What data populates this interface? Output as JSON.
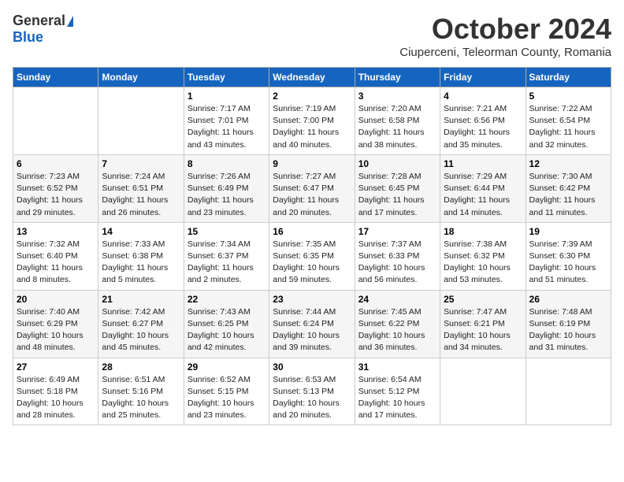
{
  "logo": {
    "general": "General",
    "blue": "Blue"
  },
  "title": "October 2024",
  "location": "Ciuperceni, Teleorman County, Romania",
  "days_of_week": [
    "Sunday",
    "Monday",
    "Tuesday",
    "Wednesday",
    "Thursday",
    "Friday",
    "Saturday"
  ],
  "weeks": [
    [
      {
        "day": "",
        "info": ""
      },
      {
        "day": "",
        "info": ""
      },
      {
        "day": "1",
        "info": "Sunrise: 7:17 AM\nSunset: 7:01 PM\nDaylight: 11 hours and 43 minutes."
      },
      {
        "day": "2",
        "info": "Sunrise: 7:19 AM\nSunset: 7:00 PM\nDaylight: 11 hours and 40 minutes."
      },
      {
        "day": "3",
        "info": "Sunrise: 7:20 AM\nSunset: 6:58 PM\nDaylight: 11 hours and 38 minutes."
      },
      {
        "day": "4",
        "info": "Sunrise: 7:21 AM\nSunset: 6:56 PM\nDaylight: 11 hours and 35 minutes."
      },
      {
        "day": "5",
        "info": "Sunrise: 7:22 AM\nSunset: 6:54 PM\nDaylight: 11 hours and 32 minutes."
      }
    ],
    [
      {
        "day": "6",
        "info": "Sunrise: 7:23 AM\nSunset: 6:52 PM\nDaylight: 11 hours and 29 minutes."
      },
      {
        "day": "7",
        "info": "Sunrise: 7:24 AM\nSunset: 6:51 PM\nDaylight: 11 hours and 26 minutes."
      },
      {
        "day": "8",
        "info": "Sunrise: 7:26 AM\nSunset: 6:49 PM\nDaylight: 11 hours and 23 minutes."
      },
      {
        "day": "9",
        "info": "Sunrise: 7:27 AM\nSunset: 6:47 PM\nDaylight: 11 hours and 20 minutes."
      },
      {
        "day": "10",
        "info": "Sunrise: 7:28 AM\nSunset: 6:45 PM\nDaylight: 11 hours and 17 minutes."
      },
      {
        "day": "11",
        "info": "Sunrise: 7:29 AM\nSunset: 6:44 PM\nDaylight: 11 hours and 14 minutes."
      },
      {
        "day": "12",
        "info": "Sunrise: 7:30 AM\nSunset: 6:42 PM\nDaylight: 11 hours and 11 minutes."
      }
    ],
    [
      {
        "day": "13",
        "info": "Sunrise: 7:32 AM\nSunset: 6:40 PM\nDaylight: 11 hours and 8 minutes."
      },
      {
        "day": "14",
        "info": "Sunrise: 7:33 AM\nSunset: 6:38 PM\nDaylight: 11 hours and 5 minutes."
      },
      {
        "day": "15",
        "info": "Sunrise: 7:34 AM\nSunset: 6:37 PM\nDaylight: 11 hours and 2 minutes."
      },
      {
        "day": "16",
        "info": "Sunrise: 7:35 AM\nSunset: 6:35 PM\nDaylight: 10 hours and 59 minutes."
      },
      {
        "day": "17",
        "info": "Sunrise: 7:37 AM\nSunset: 6:33 PM\nDaylight: 10 hours and 56 minutes."
      },
      {
        "day": "18",
        "info": "Sunrise: 7:38 AM\nSunset: 6:32 PM\nDaylight: 10 hours and 53 minutes."
      },
      {
        "day": "19",
        "info": "Sunrise: 7:39 AM\nSunset: 6:30 PM\nDaylight: 10 hours and 51 minutes."
      }
    ],
    [
      {
        "day": "20",
        "info": "Sunrise: 7:40 AM\nSunset: 6:29 PM\nDaylight: 10 hours and 48 minutes."
      },
      {
        "day": "21",
        "info": "Sunrise: 7:42 AM\nSunset: 6:27 PM\nDaylight: 10 hours and 45 minutes."
      },
      {
        "day": "22",
        "info": "Sunrise: 7:43 AM\nSunset: 6:25 PM\nDaylight: 10 hours and 42 minutes."
      },
      {
        "day": "23",
        "info": "Sunrise: 7:44 AM\nSunset: 6:24 PM\nDaylight: 10 hours and 39 minutes."
      },
      {
        "day": "24",
        "info": "Sunrise: 7:45 AM\nSunset: 6:22 PM\nDaylight: 10 hours and 36 minutes."
      },
      {
        "day": "25",
        "info": "Sunrise: 7:47 AM\nSunset: 6:21 PM\nDaylight: 10 hours and 34 minutes."
      },
      {
        "day": "26",
        "info": "Sunrise: 7:48 AM\nSunset: 6:19 PM\nDaylight: 10 hours and 31 minutes."
      }
    ],
    [
      {
        "day": "27",
        "info": "Sunrise: 6:49 AM\nSunset: 5:18 PM\nDaylight: 10 hours and 28 minutes."
      },
      {
        "day": "28",
        "info": "Sunrise: 6:51 AM\nSunset: 5:16 PM\nDaylight: 10 hours and 25 minutes."
      },
      {
        "day": "29",
        "info": "Sunrise: 6:52 AM\nSunset: 5:15 PM\nDaylight: 10 hours and 23 minutes."
      },
      {
        "day": "30",
        "info": "Sunrise: 6:53 AM\nSunset: 5:13 PM\nDaylight: 10 hours and 20 minutes."
      },
      {
        "day": "31",
        "info": "Sunrise: 6:54 AM\nSunset: 5:12 PM\nDaylight: 10 hours and 17 minutes."
      },
      {
        "day": "",
        "info": ""
      },
      {
        "day": "",
        "info": ""
      }
    ]
  ]
}
